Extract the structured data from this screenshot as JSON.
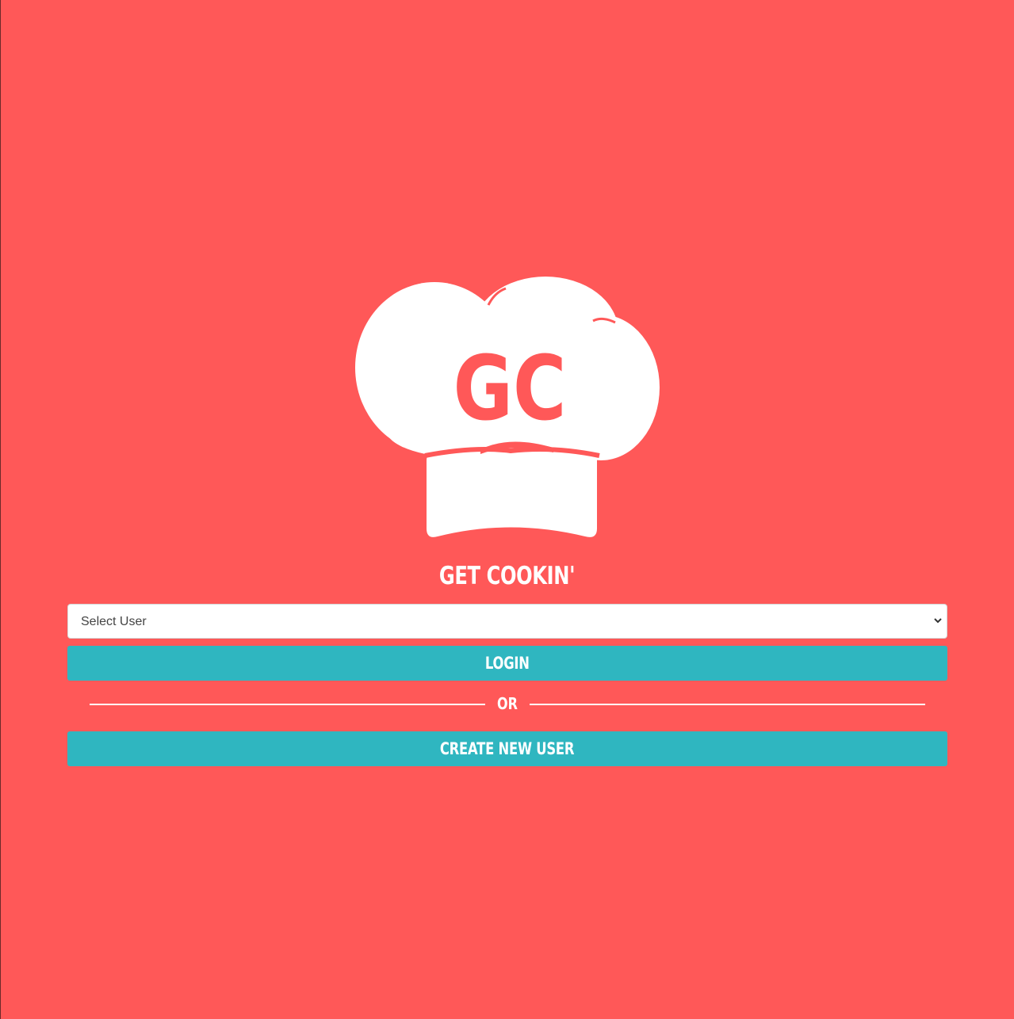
{
  "colors": {
    "background": "#ff5858",
    "accent_button": "#2fb6c0",
    "text_light": "#ffffff"
  },
  "logo": {
    "icon": "chef-hat-icon",
    "monogram": "GC"
  },
  "app_title": "GET COOKIN'",
  "user_select": {
    "selected_value": "Select User",
    "options": [
      "Select User"
    ]
  },
  "login_button_label": "LOGIN",
  "divider_text": "OR",
  "create_user_button_label": "CREATE NEW USER"
}
